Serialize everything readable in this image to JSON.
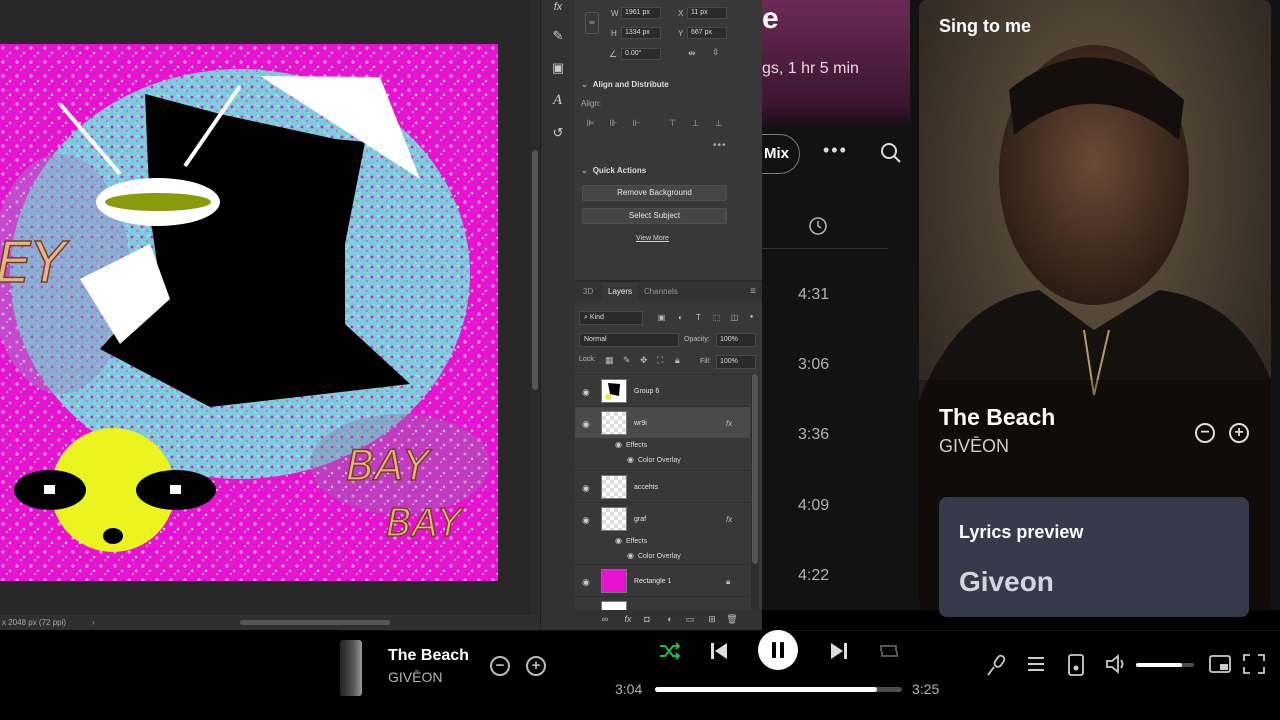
{
  "photoshop": {
    "canvas": {
      "graffiti_text_1": "EY",
      "graffiti_text_2": "BAY",
      "graffiti_text_3": "BAY"
    },
    "status_text": "x 2048 px (72 ppi)",
    "tools": [
      "fx",
      "brush",
      "3d",
      "A",
      "history"
    ],
    "properties": {
      "w_label": "W",
      "w_value": "1961 px",
      "x_label": "X",
      "x_value": "11 px",
      "h_label": "H",
      "h_value": "1334 px",
      "y_label": "Y",
      "y_value": "667 px",
      "angle_value": "0.00°",
      "align_section": "Align and Distribute",
      "align_label": "Align:",
      "quick_actions_section": "Quick Actions",
      "remove_background": "Remove Background",
      "select_subject": "Select Subject",
      "view_more": "View More"
    },
    "layers_panel": {
      "tabs": [
        "3D",
        "Layers",
        "Channels"
      ],
      "kind_filter": "Kind",
      "blend_mode": "Normal",
      "opacity_label": "Opacity:",
      "opacity_value": "100%",
      "lock_label": "Lock:",
      "fill_label": "Fill:",
      "fill_value": "100%",
      "layers": [
        {
          "name": "Group 6"
        },
        {
          "name": "wr9i",
          "effects_label": "Effects",
          "effect": "Color Overlay"
        },
        {
          "name": "accehts"
        },
        {
          "name": "graf",
          "effects_label": "Effects",
          "effect": "Color Overlay"
        },
        {
          "name": "Rectangle 1"
        }
      ],
      "fx_mark": "fx"
    }
  },
  "spotify": {
    "playlist": {
      "title_fragment": "e",
      "meta": "gs, 1 hr 5 min",
      "mix_label": "Mix",
      "more_label": "•••",
      "durations": [
        "4:31",
        "3:06",
        "3:36",
        "4:09",
        "4:22"
      ]
    },
    "now_playing_panel": {
      "title": "Sing to me",
      "song": "The Beach",
      "artist": "GIVĒON",
      "lyrics_heading": "Lyrics preview",
      "lyrics_line": "Giveon"
    },
    "player": {
      "song": "The Beach",
      "artist": "GIVĒON",
      "elapsed": "3:04",
      "duration": "3:25",
      "progress_fraction": 0.9,
      "volume_fraction": 0.8,
      "accent_color": "#1db954"
    }
  }
}
